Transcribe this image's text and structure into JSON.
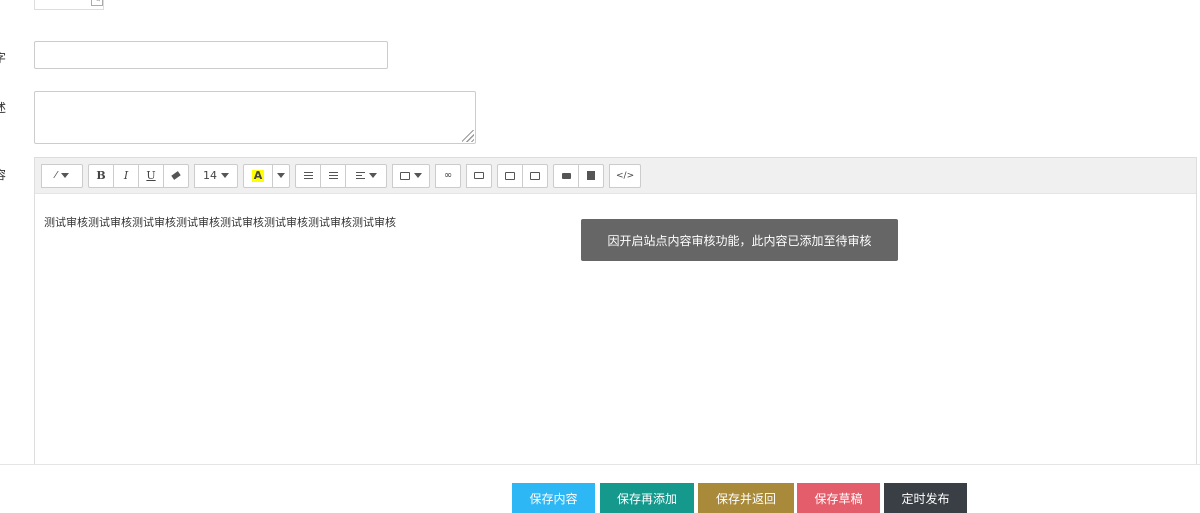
{
  "form": {
    "keyword_label": "字",
    "description_label": "述",
    "content_label": "容",
    "keyword_value": "",
    "description_value": ""
  },
  "toolbar": {
    "font_size": "14",
    "color_letter": "A",
    "icons": [
      "magic-wand-icon",
      "bold-icon",
      "italic-icon",
      "underline-icon",
      "eraser-icon",
      "font-size-dropdown",
      "text-color-icon",
      "unordered-list-icon",
      "ordered-list-icon",
      "align-icon",
      "table-icon",
      "link-icon",
      "folder-icon",
      "image-icon",
      "image-alt-icon",
      "video-icon",
      "file-icon",
      "code-view-icon"
    ],
    "bold": "B",
    "italic": "I",
    "underline": "U"
  },
  "editor": {
    "content": "测试审核测试审核测试审核测试审核测试审核测试审核测试审核测试审核"
  },
  "toast": {
    "message": "因开启站点内容审核功能，此内容已添加至待审核"
  },
  "actions": [
    {
      "label": "保存内容",
      "color": "#2db7f5"
    },
    {
      "label": "保存再添加",
      "color": "#15998c"
    },
    {
      "label": "保存并返回",
      "color": "#a88a3a"
    },
    {
      "label": "保存草稿",
      "color": "#e35d6a"
    },
    {
      "label": "定时发布",
      "color": "#3a3f45"
    }
  ]
}
